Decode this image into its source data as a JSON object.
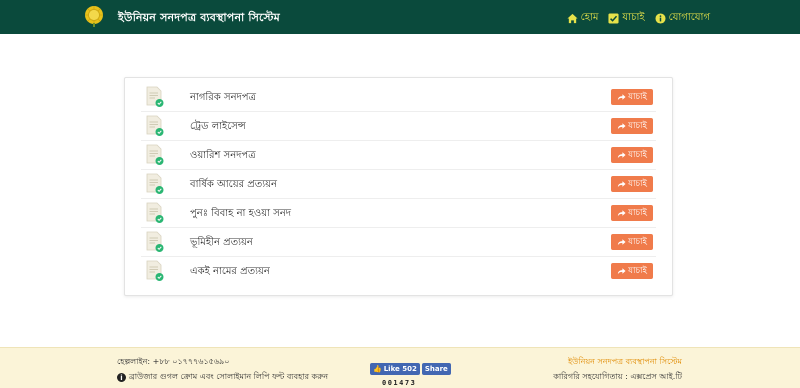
{
  "header": {
    "brand": "ইউনিয়ন সনদপত্র ব্যবস্থাপনা সিস্টেম",
    "nav": [
      {
        "label": "হোম",
        "icon": "home-icon"
      },
      {
        "label": "যাচাই",
        "icon": "check-square-icon"
      },
      {
        "label": "যোগাযোগ",
        "icon": "info-circle-icon"
      }
    ]
  },
  "certificates": [
    {
      "label": "নাগরিক সনদপত্র",
      "button": "যাচাই"
    },
    {
      "label": "ট্রেড লাইসেন্স",
      "button": "যাচাই"
    },
    {
      "label": "ওয়ারিশ সনদপত্র",
      "button": "যাচাই"
    },
    {
      "label": "বার্ষিক আয়ের প্রত্যয়ন",
      "button": "যাচাই"
    },
    {
      "label": "পুনঃ বিবাহ না হওয়া সনদ",
      "button": "যাচাই"
    },
    {
      "label": "ভূমিহীন প্রত্যয়ন",
      "button": "যাচাই"
    },
    {
      "label": "একই নামের প্রত্যয়ন",
      "button": "যাচাই"
    }
  ],
  "footer": {
    "helpline": "হেল্পলাইন: +৮৮ ০১৭৭৭৬১৫৬৯০",
    "browser_note": "ব্রাউজার গুগল ক্রোম এবং সোলাইমান লিপি ফন্ট ব্যবহার করুন",
    "fb_like": "Like 502",
    "fb_share": "Share",
    "counter": "001473",
    "title": "ইউনিয়ন সনদপত্র ব্যবস্থাপনা সিস্টেম",
    "credit": "কারিগরি সহযোগিতায় : এক্সপ্রেস আই.টি"
  },
  "colors": {
    "navbar": "#0a4a3c",
    "nav_text": "#e6e24a",
    "button": "#f07b4b",
    "footer_bg": "#fbf4d8",
    "footer_title": "#e08a00"
  }
}
